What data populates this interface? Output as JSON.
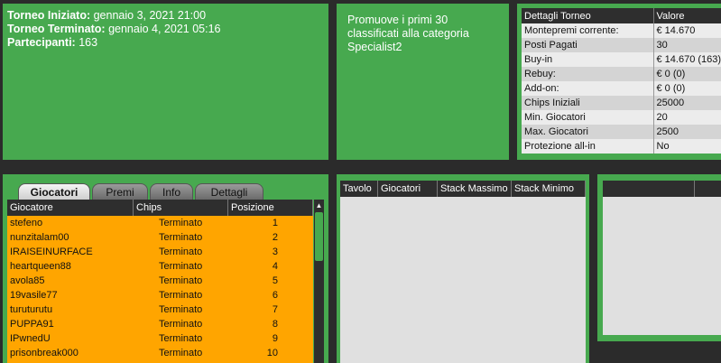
{
  "info": {
    "started_label": "Torneo Iniziato:",
    "started_value": "gennaio 3, 2021 21:00",
    "ended_label": "Torneo Terminato:",
    "ended_value": "gennaio 4, 2021 05:16",
    "participants_label": "Partecipanti:",
    "participants_value": "163"
  },
  "promo": {
    "text": "Promuove i primi 30 classificati alla categoria Specialist2"
  },
  "details": {
    "headers": [
      "Dettagli Torneo",
      "Valore"
    ],
    "rows": [
      [
        "Montepremi corrente:",
        "€ 14.670"
      ],
      [
        "Posti Pagati",
        "30"
      ],
      [
        "Buy-in",
        "€ 14.670 (163)"
      ],
      [
        "Rebuy:",
        "€ 0 (0)"
      ],
      [
        "Add-on:",
        "€ 0 (0)"
      ],
      [
        "Chips Iniziali",
        "25000"
      ],
      [
        "Min. Giocatori",
        "20"
      ],
      [
        "Max. Giocatori",
        "2500"
      ],
      [
        "Protezione all-in",
        "No"
      ]
    ]
  },
  "tabs": [
    "Giocatori",
    "Premi",
    "Info",
    "Dettagli"
  ],
  "players": {
    "headers": [
      "Giocatore",
      "Chips",
      "Posizione"
    ],
    "rows": [
      [
        "stefeno",
        "Terminato",
        "1"
      ],
      [
        "nunzitalam00",
        "Terminato",
        "2"
      ],
      [
        "IRAISEINURFACE",
        "Terminato",
        "3"
      ],
      [
        "heartqueen88",
        "Terminato",
        "4"
      ],
      [
        "avola85",
        "Terminato",
        "5"
      ],
      [
        "19vasile77",
        "Terminato",
        "6"
      ],
      [
        "turuturutu",
        "Terminato",
        "7"
      ],
      [
        "PUPPA91",
        "Terminato",
        "8"
      ],
      [
        "IPwnedU",
        "Terminato",
        "9"
      ],
      [
        "prisonbreak000",
        "Terminato",
        "10"
      ]
    ]
  },
  "tables": {
    "headers": [
      "Tavolo",
      "Giocatori",
      "Stack Massimo",
      "Stack Minimo"
    ]
  },
  "icons": {
    "scroll_up": "▲"
  },
  "colors": {
    "panel": "#47a94f",
    "player_rows": "#ffa500",
    "header": "#2e2e2e"
  }
}
